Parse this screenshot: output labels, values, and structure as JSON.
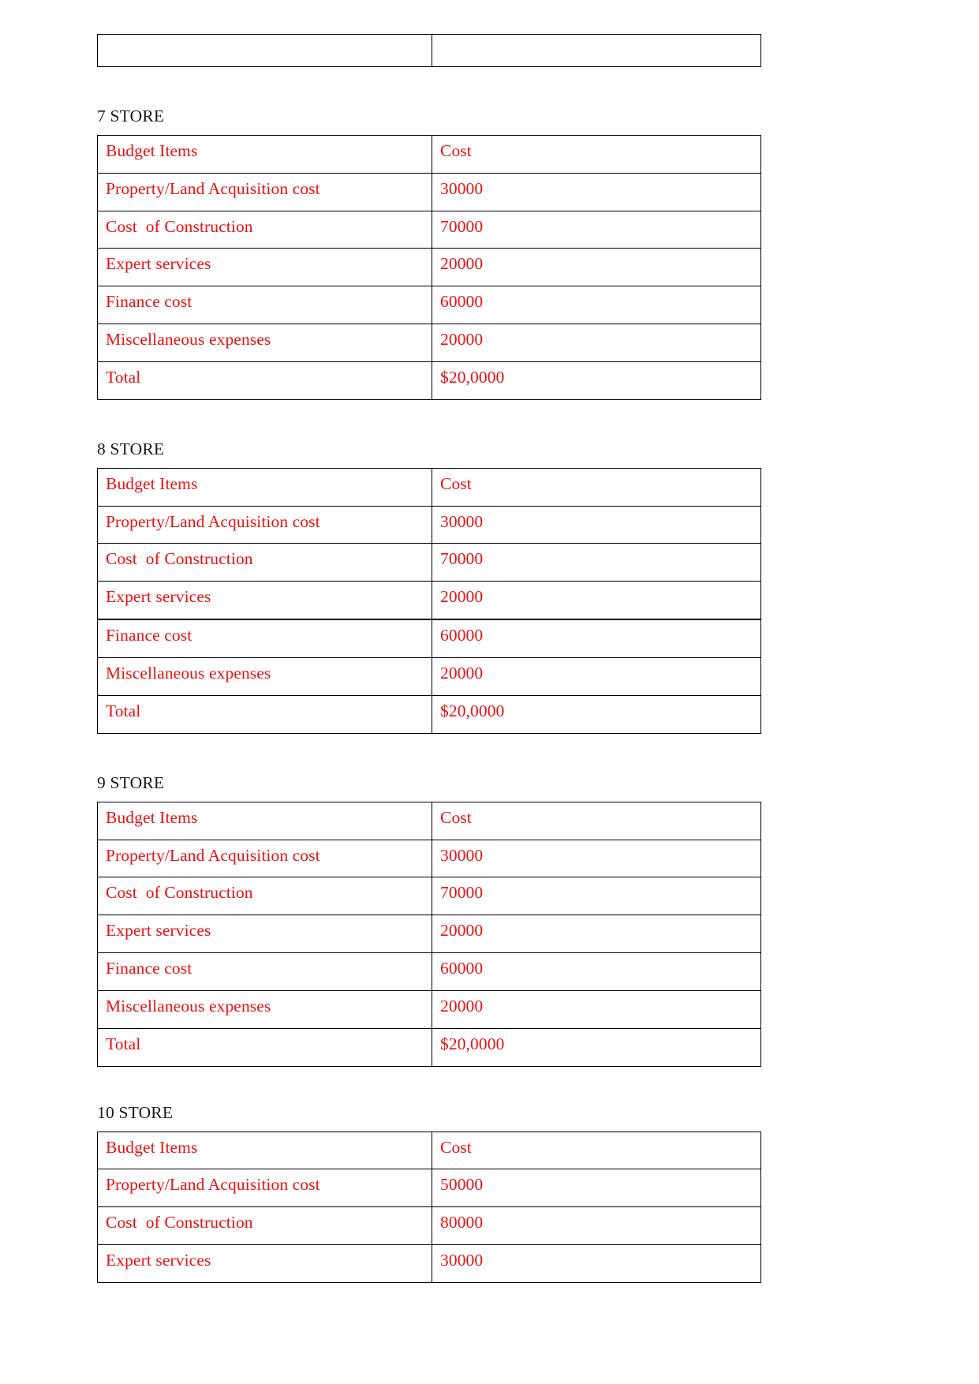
{
  "document": {
    "text_color": "#ee1111",
    "heading_color": "#1a1a1a",
    "border_color": "#000000",
    "columns": [
      "Budget Items",
      "Cost"
    ]
  },
  "lead_table": {
    "name": "empty-table",
    "rows": [
      {
        "cells": [
          "",
          ""
        ]
      }
    ]
  },
  "sections": [
    {
      "heading": "7 STORE",
      "table": {
        "header": {
          "item": "Budget Items",
          "cost": "Cost"
        },
        "rows": [
          {
            "item": "Property/Land Acquisition cost",
            "cost": "30000"
          },
          {
            "item": "Cost  of Construction",
            "cost": "70000"
          },
          {
            "item": "Expert services",
            "cost": "20000"
          },
          {
            "item": "Finance cost",
            "cost": "60000"
          },
          {
            "item": "Miscellaneous expenses",
            "cost": "20000"
          },
          {
            "item": "Total",
            "cost": "$20,0000"
          }
        ]
      }
    },
    {
      "heading": "8 STORE",
      "table": {
        "header": {
          "item": "Budget Items",
          "cost": "Cost"
        },
        "rows": [
          {
            "item": "Property/Land Acquisition cost",
            "cost": "30000"
          },
          {
            "item": "Cost  of Construction",
            "cost": "70000"
          },
          {
            "item": "Expert services",
            "cost": "20000"
          },
          {
            "item": "Finance cost",
            "cost": "60000"
          },
          {
            "item": "Miscellaneous expenses",
            "cost": "20000"
          },
          {
            "item": "Total",
            "cost": "$20,0000"
          }
        ]
      }
    },
    {
      "heading": "9 STORE",
      "table": {
        "header": {
          "item": "Budget Items",
          "cost": "Cost"
        },
        "rows": [
          {
            "item": "Property/Land Acquisition cost",
            "cost": "30000"
          },
          {
            "item": "Cost  of Construction",
            "cost": "70000"
          },
          {
            "item": "Expert services",
            "cost": "20000"
          },
          {
            "item": "Finance cost",
            "cost": "60000"
          },
          {
            "item": "Miscellaneous expenses",
            "cost": "20000"
          },
          {
            "item": "Total",
            "cost": "$20,0000"
          }
        ]
      }
    },
    {
      "heading": "10 STORE",
      "table": {
        "header": {
          "item": "Budget Items",
          "cost": "Cost"
        },
        "rows": [
          {
            "item": "Property/Land Acquisition cost",
            "cost": "50000"
          },
          {
            "item": "Cost  of Construction",
            "cost": "80000"
          },
          {
            "item": "Expert services",
            "cost": "30000"
          }
        ]
      }
    }
  ]
}
